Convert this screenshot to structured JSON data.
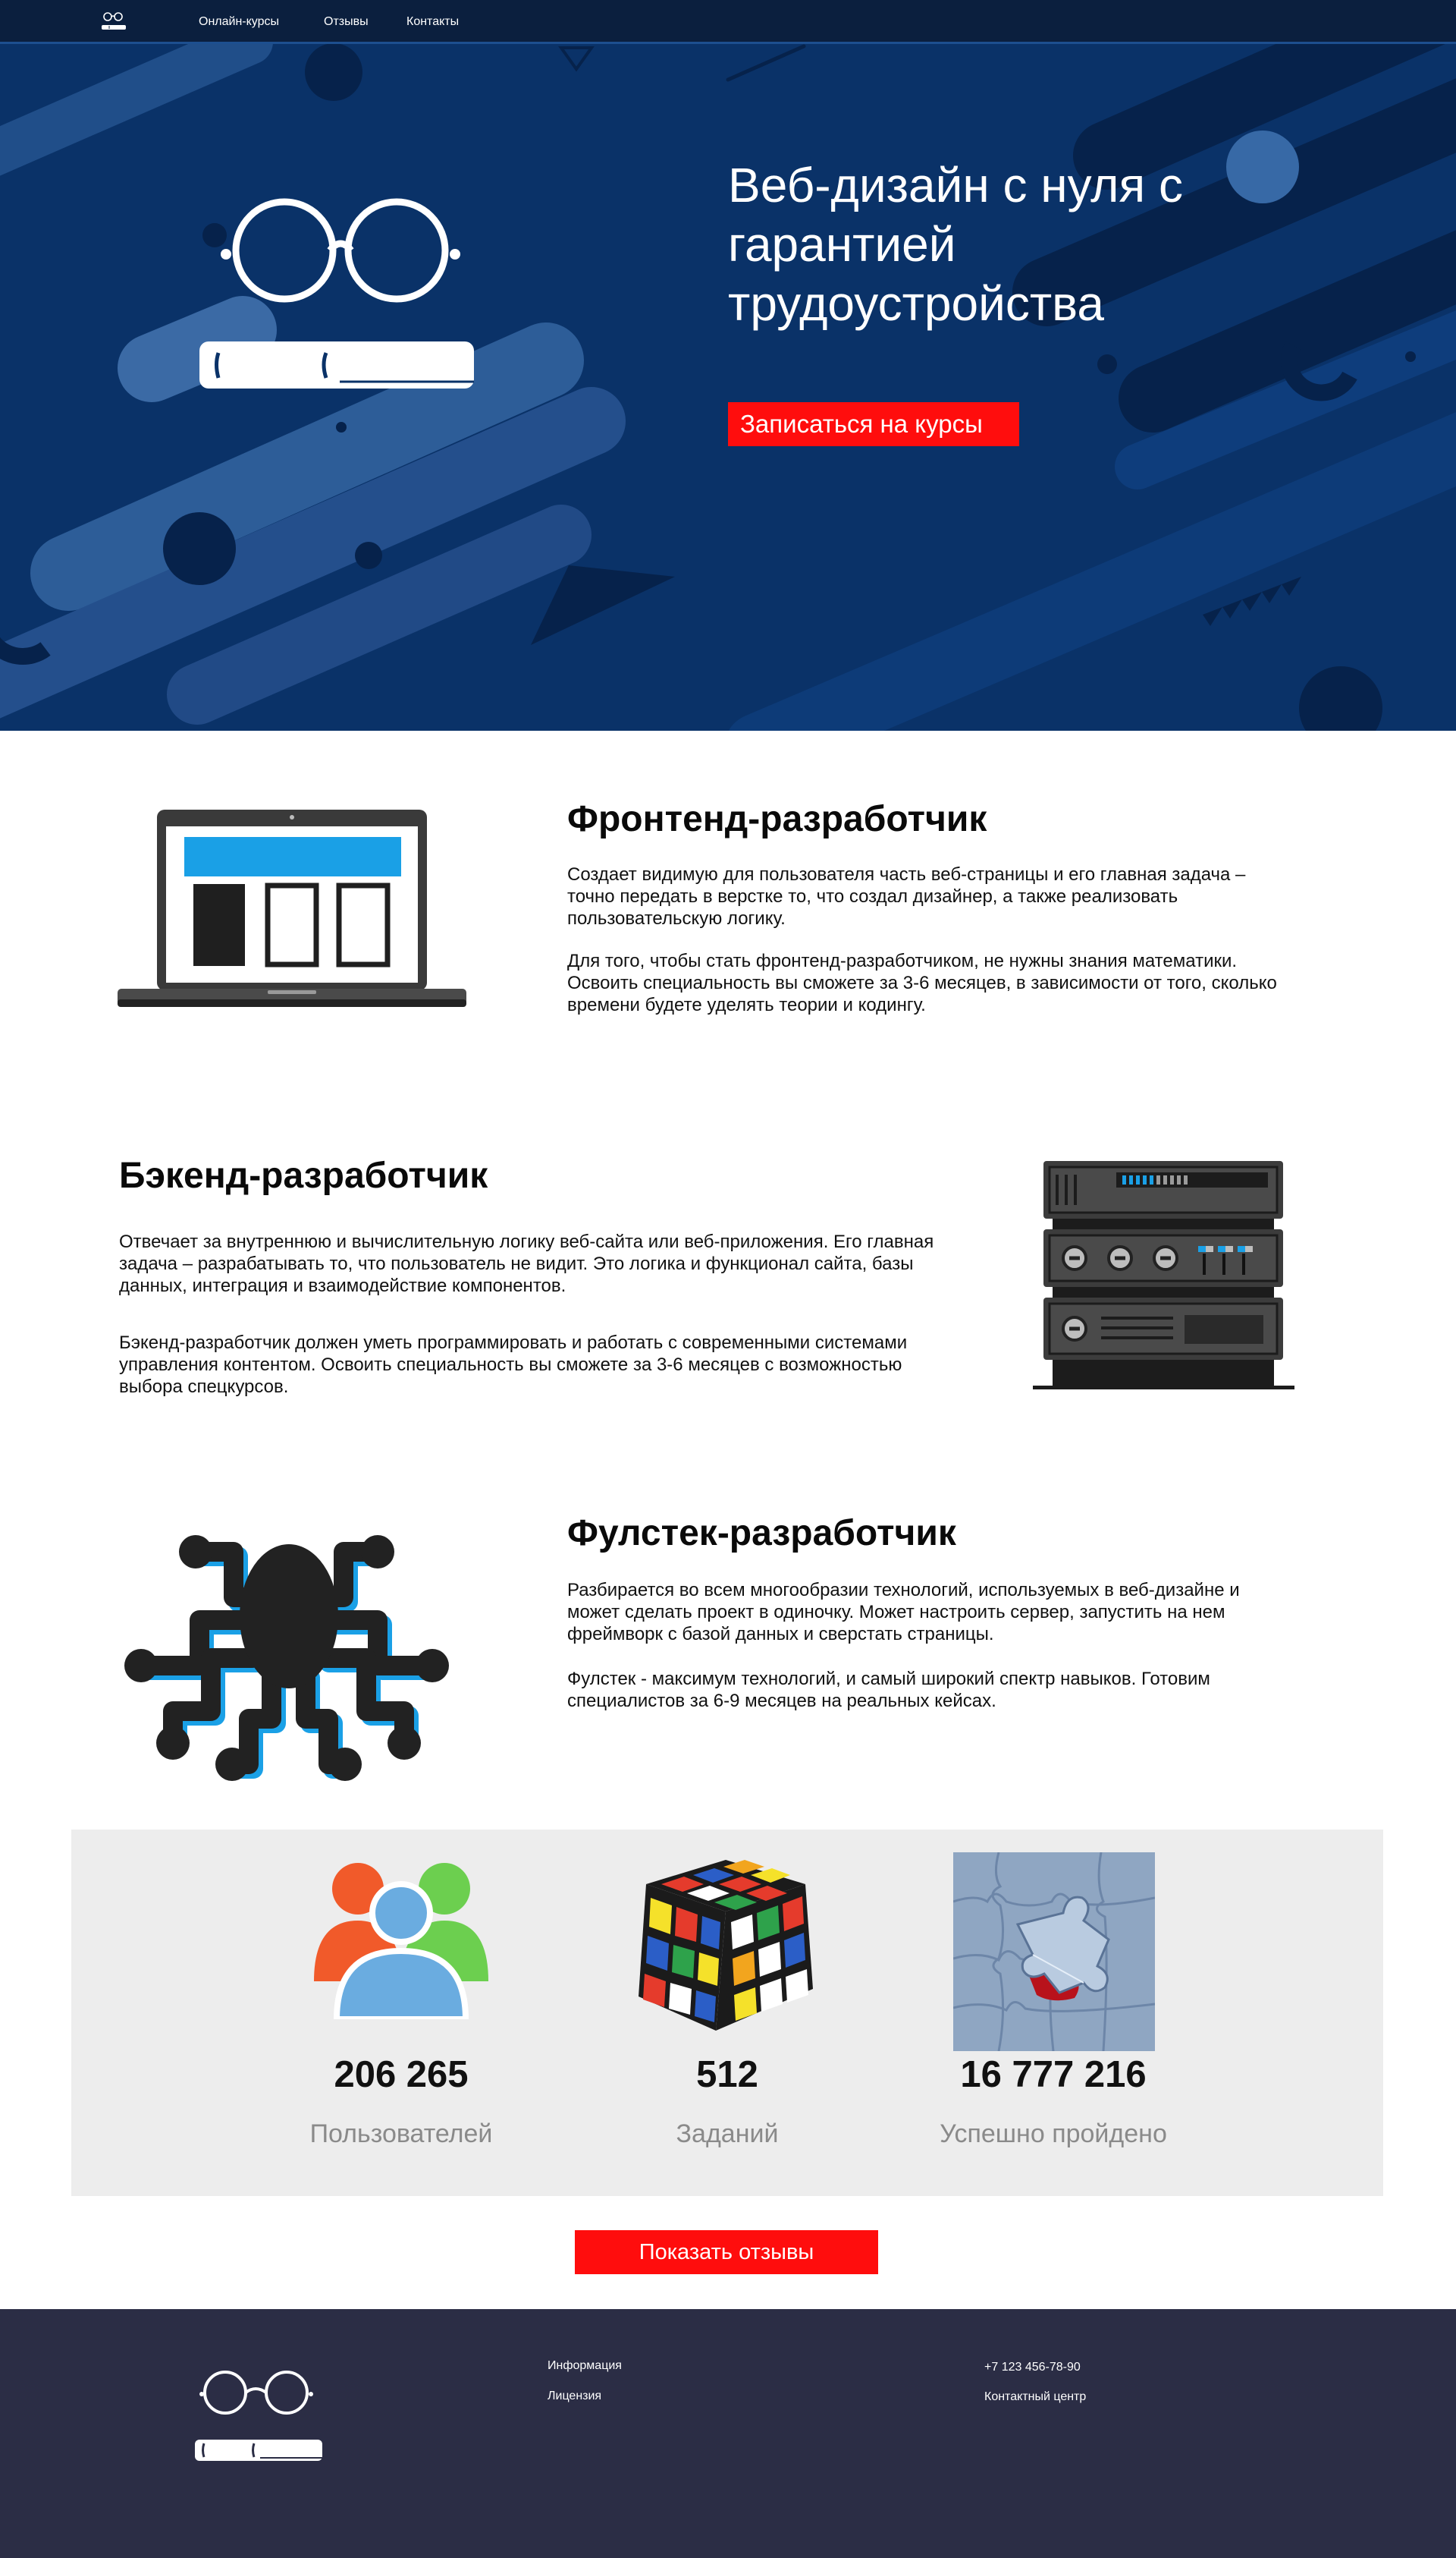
{
  "nav": {
    "logo_name": "glasses-book-logo",
    "links": [
      "Онлайн-курсы",
      "Отзывы",
      "Контакты"
    ]
  },
  "hero": {
    "title": "Веб-дизайн с нуля с гарантией трудоустройства",
    "cta": "Записаться на курсы",
    "colors": {
      "background": "#0a3268",
      "accent": "#ff0d0d"
    }
  },
  "sections": [
    {
      "title": "Фронтенд-разработчик",
      "p1": "Создает видимую для пользователя часть веб-страницы и его главная задача – точно передать в верстке то, что создал дизайнер, а также реализовать пользовательскую логику.",
      "p2": "Для того, чтобы стать фронтенд-разработчиком, не нужны знания математики. Освоить специальность вы сможете за 3-6 месяцев, в зависимости от того, сколько времени будете уделять теории и кодингу.",
      "icon": "laptop-icon"
    },
    {
      "title": "Бэкенд-разработчик",
      "p1": "Отвечает за внутреннюю и вычислительную логику веб-сайта или веб-приложения. Его главная задача – разрабатывать то, что пользователь не видит. Это логика и функционал сайта, базы данных, интеграция и взаимодействие компонентов.",
      "p2": "Бэкенд-разработчик должен уметь программировать и работать с современными системами управления контентом. Освоить специальность вы сможете за 3-6 месяцев с возможностью выбора спецкурсов.",
      "icon": "server-icon"
    },
    {
      "title": "Фулстек-разработчик",
      "p1": "Разбирается во всем многообразии технологий, используемых в веб-дизайне и может сделать проект в одиночку. Может настроить сервер, запустить на нем фреймворк с базой данных и сверстать страницы.",
      "p2": "Фулстек - максимум технологий, и самый широкий спектр навыков. Готовим специалистов за 6-9 месяцев на реальных кейсах.",
      "icon": "octopus-icon"
    }
  ],
  "stats": [
    {
      "value": "206 265",
      "label": "Пользователей",
      "icon": "users-icon"
    },
    {
      "value": "512",
      "label": "Заданий",
      "icon": "rubiks-cube-icon"
    },
    {
      "value": "16 777 216",
      "label": "Успешно пройдено",
      "icon": "puzzle-icon"
    }
  ],
  "reviews_button": "Показать отзывы",
  "footer": {
    "col1": [
      "Информация",
      "Лицензия"
    ],
    "col2": [
      "+7 123 456-78-90",
      "Контактный центр"
    ]
  }
}
